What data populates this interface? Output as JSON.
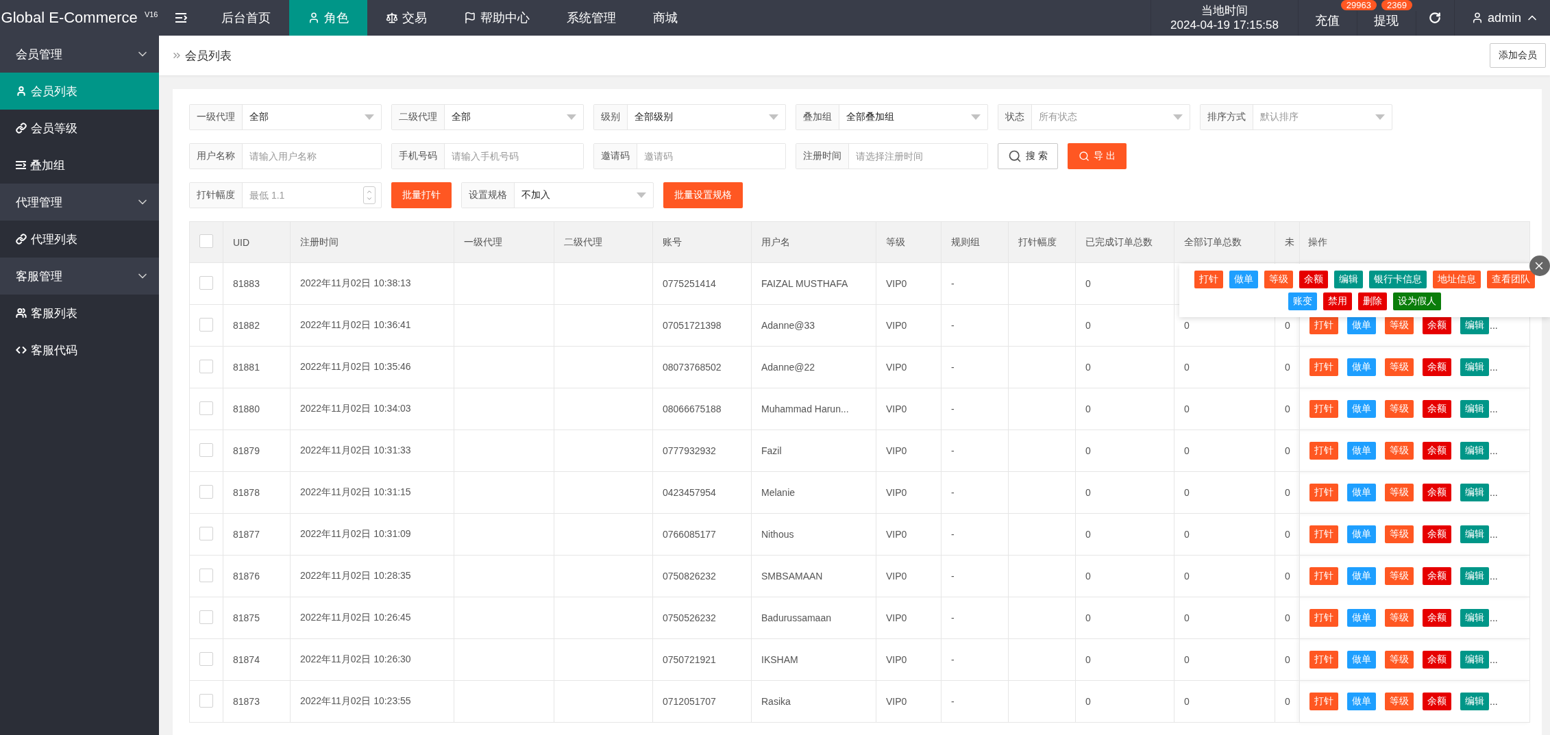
{
  "header": {
    "logo": "Global E-Commerce $^{V16}$",
    "nav": [
      {
        "label": "后台首页",
        "selected": false
      },
      {
        "label": "角色",
        "selected": true
      },
      {
        "label": "交易",
        "selected": false
      },
      {
        "label": "帮助中心",
        "selected": false
      },
      {
        "label": "系统管理",
        "selected": false
      },
      {
        "label": "商城",
        "selected": false
      }
    ],
    "clock": {
      "label": "当地时间",
      "time": "2024-04-19 17:15:58"
    },
    "links": [
      {
        "label": "充值",
        "badge": "29963"
      },
      {
        "label": "提现",
        "badge": "2369"
      }
    ],
    "user": "admin"
  },
  "sidebar": {
    "groups": [
      {
        "title": "会员管理",
        "expanded": true,
        "items": [
          {
            "label": "会员列表",
            "selected": true
          },
          {
            "label": "会员等级",
            "selected": false
          },
          {
            "label": "叠加组",
            "selected": false
          }
        ]
      },
      {
        "title": "代理管理",
        "expanded": true,
        "items": [
          {
            "label": "代理列表",
            "selected": false
          }
        ]
      },
      {
        "title": "客服管理",
        "expanded": true,
        "items": [
          {
            "label": "客服列表",
            "selected": false
          },
          {
            "label": "客服代码",
            "selected": false
          }
        ]
      }
    ]
  },
  "breadcrumb": "会员列表",
  "add_button": "添加会员",
  "filters": [
    [
      {
        "kind": "select",
        "label": "一级代理",
        "value": "全部"
      },
      {
        "kind": "select",
        "label": "二级代理",
        "value": "全部"
      },
      {
        "kind": "select",
        "label": "级别",
        "value": "全部级别"
      },
      {
        "kind": "select",
        "label": "叠加组",
        "value": "全部叠加组"
      },
      {
        "kind": "select",
        "label": "状态",
        "placeholder": "所有状态"
      },
      {
        "kind": "select",
        "label": "排序方式",
        "placeholder": "默认排序"
      }
    ],
    [
      {
        "kind": "input",
        "label": "用户名称",
        "placeholder": "请输入用户名称"
      },
      {
        "kind": "input",
        "label": "手机号码",
        "placeholder": "请输入手机号码"
      },
      {
        "kind": "input",
        "label": "邀请码",
        "placeholder": "邀请码"
      },
      {
        "kind": "input",
        "label": "注册时间",
        "placeholder": "请选择注册时间"
      },
      {
        "kind": "search-button",
        "label": "搜 索"
      },
      {
        "kind": "export-button",
        "label": "导 出"
      }
    ],
    [
      {
        "kind": "number",
        "label": "打针幅度",
        "placeholder": "最低 1.1"
      },
      {
        "kind": "accent-button",
        "label": "批量打针"
      },
      {
        "kind": "select",
        "label": "设置规格",
        "value": "不加入"
      },
      {
        "kind": "accent-button",
        "label": "批量设置规格"
      }
    ]
  ],
  "table": {
    "header_checked": false,
    "columns": [
      "UID",
      "注册时间",
      "一级代理",
      "二级代理",
      "账号",
      "用户名",
      "等级",
      "规则组",
      "打针幅度",
      "已完成订单总数",
      "全部订单总数",
      "未",
      "操作"
    ],
    "rows": [
      {
        "checked": false,
        "uid": "81883",
        "registered": "2022年11月02日 10:38:13",
        "account": "0775251414",
        "username": "FAIZAL MUSTHAFA",
        "grade": "VIP0",
        "rule_group": "-",
        "completed": "0"
      },
      {
        "checked": false,
        "uid": "81882",
        "registered": "2022年11月02日 10:36:41",
        "account": "07051721398",
        "username": "Adanne@33",
        "grade": "VIP0",
        "rule_group": "-",
        "completed": "0",
        "total": "0",
        "column_13": "0",
        "actions": [
          {
            "label": "打针",
            "color": "#ff5722"
          },
          {
            "label": "做单",
            "color": "#1e9fff"
          },
          {
            "label": "等级",
            "color": "#ff5722"
          },
          {
            "label": "余额",
            "color": "#e60000"
          },
          {
            "label": "编辑",
            "color": "#009688"
          }
        ],
        "more": "..."
      },
      {
        "checked": false,
        "uid": "81881",
        "registered": "2022年11月02日 10:35:46",
        "account": "08073768502",
        "username": "Adanne@22",
        "grade": "VIP0",
        "rule_group": "-",
        "completed": "0",
        "total": "0",
        "column_13": "0",
        "actions": [
          {
            "label": "打针",
            "color": "#ff5722"
          },
          {
            "label": "做单",
            "color": "#1e9fff"
          },
          {
            "label": "等级",
            "color": "#ff5722"
          },
          {
            "label": "余额",
            "color": "#e60000"
          },
          {
            "label": "编辑",
            "color": "#009688"
          }
        ],
        "more": "..."
      },
      {
        "checked": false,
        "uid": "81880",
        "registered": "2022年11月02日 10:34:03",
        "account": "08066675188",
        "username": "Muhammad Harun...",
        "grade": "VIP0",
        "rule_group": "-",
        "completed": "0",
        "total": "0",
        "column_13": "0",
        "actions": [
          {
            "label": "打针",
            "color": "#ff5722"
          },
          {
            "label": "做单",
            "color": "#1e9fff"
          },
          {
            "label": "等级",
            "color": "#ff5722"
          },
          {
            "label": "余额",
            "color": "#e60000"
          },
          {
            "label": "编辑",
            "color": "#009688"
          }
        ],
        "more": "..."
      },
      {
        "checked": false,
        "uid": "81879",
        "registered": "2022年11月02日 10:31:33",
        "account": "0777932932",
        "username": "Fazil",
        "grade": "VIP0",
        "rule_group": "-",
        "completed": "0",
        "total": "0",
        "column_13": "0",
        "actions": [
          {
            "label": "打针",
            "color": "#ff5722"
          },
          {
            "label": "做单",
            "color": "#1e9fff"
          },
          {
            "label": "等级",
            "color": "#ff5722"
          },
          {
            "label": "余额",
            "color": "#e60000"
          },
          {
            "label": "编辑",
            "color": "#009688"
          }
        ],
        "more": "..."
      },
      {
        "checked": false,
        "uid": "81878",
        "registered": "2022年11月02日 10:31:15",
        "account": "0423457954",
        "username": "Melanie",
        "grade": "VIP0",
        "rule_group": "-",
        "completed": "0",
        "total": "0",
        "column_13": "0",
        "actions": [
          {
            "label": "打针",
            "color": "#ff5722"
          },
          {
            "label": "做单",
            "color": "#1e9fff"
          },
          {
            "label": "等级",
            "color": "#ff5722"
          },
          {
            "label": "余额",
            "color": "#e60000"
          },
          {
            "label": "编辑",
            "color": "#009688"
          }
        ],
        "more": "..."
      },
      {
        "checked": false,
        "uid": "81877",
        "registered": "2022年11月02日 10:31:09",
        "account": "0766085177",
        "username": "Nithous",
        "grade": "VIP0",
        "rule_group": "-",
        "completed": "0",
        "total": "0",
        "column_13": "0",
        "actions": [
          {
            "label": "打针",
            "color": "#ff5722"
          },
          {
            "label": "做单",
            "color": "#1e9fff"
          },
          {
            "label": "等级",
            "color": "#ff5722"
          },
          {
            "label": "余额",
            "color": "#e60000"
          },
          {
            "label": "编辑",
            "color": "#009688"
          }
        ],
        "more": "..."
      },
      {
        "checked": false,
        "uid": "81876",
        "registered": "2022年11月02日 10:28:35",
        "account": "0750826232",
        "username": "SMBSAMAAN",
        "grade": "VIP0",
        "rule_group": "-",
        "completed": "0",
        "total": "0",
        "column_13": "0",
        "actions": [
          {
            "label": "打针",
            "color": "#ff5722"
          },
          {
            "label": "做单",
            "color": "#1e9fff"
          },
          {
            "label": "等级",
            "color": "#ff5722"
          },
          {
            "label": "余额",
            "color": "#e60000"
          },
          {
            "label": "编辑",
            "color": "#009688"
          }
        ],
        "more": "..."
      },
      {
        "checked": false,
        "uid": "81875",
        "registered": "2022年11月02日 10:26:45",
        "account": "0750526232",
        "username": "Badurussamaan",
        "grade": "VIP0",
        "rule_group": "-",
        "completed": "0",
        "total": "0",
        "column_13": "0",
        "actions": [
          {
            "label": "打针",
            "color": "#ff5722"
          },
          {
            "label": "做单",
            "color": "#1e9fff"
          },
          {
            "label": "等级",
            "color": "#ff5722"
          },
          {
            "label": "余额",
            "color": "#e60000"
          },
          {
            "label": "编辑",
            "color": "#009688"
          }
        ],
        "more": "..."
      },
      {
        "checked": false,
        "uid": "81874",
        "registered": "2022年11月02日 10:26:30",
        "account": "0750721921",
        "username": "IKSHAM",
        "grade": "VIP0",
        "rule_group": "-",
        "completed": "0",
        "total": "0",
        "column_13": "0",
        "actions": [
          {
            "label": "打针",
            "color": "#ff5722"
          },
          {
            "label": "做单",
            "color": "#1e9fff"
          },
          {
            "label": "等级",
            "color": "#ff5722"
          },
          {
            "label": "余额",
            "color": "#e60000"
          },
          {
            "label": "编辑",
            "color": "#009688"
          }
        ],
        "more": "..."
      },
      {
        "checked": false,
        "uid": "81873",
        "registered": "2022年11月02日 10:23:55",
        "account": "0712051707",
        "username": "Rasika",
        "grade": "VIP0",
        "rule_group": "-",
        "completed": "0",
        "total": "0",
        "column_13": "0",
        "actions": [
          {
            "label": "打针",
            "color": "#ff5722"
          },
          {
            "label": "做单",
            "color": "#1e9fff"
          },
          {
            "label": "等级",
            "color": "#ff5722"
          },
          {
            "label": "余额",
            "color": "#e60000"
          },
          {
            "label": "编辑",
            "color": "#009688"
          }
        ],
        "more": "..."
      }
    ]
  },
  "action_popover": {
    "buttons": [
      {
        "label": "打针",
        "color": "#ff5722"
      },
      {
        "label": "做单",
        "color": "#1e9fff"
      },
      {
        "label": "等级",
        "color": "#ff5722"
      },
      {
        "label": "余额",
        "color": "#e60000"
      },
      {
        "label": "编辑",
        "color": "#009688"
      },
      {
        "label": "银行卡信息",
        "color": "#009688"
      },
      {
        "label": "地址信息",
        "color": "#ff5722"
      },
      {
        "label": "查看团队",
        "color": "#ff5722"
      },
      {
        "label": "账变",
        "color": "#1e9fff"
      },
      {
        "label": "禁用",
        "color": "#e60000"
      },
      {
        "label": "删除",
        "color": "#e60000"
      },
      {
        "label": "设为假人",
        "color": "#0a7d0a"
      }
    ]
  }
}
